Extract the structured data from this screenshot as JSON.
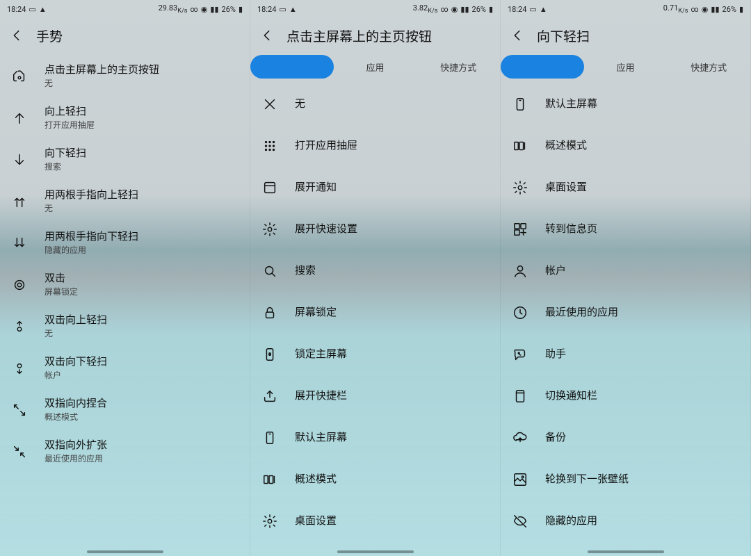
{
  "status": {
    "time": "18:24",
    "battery": "26%",
    "net": [
      {
        "rate": "29.83",
        "unit": "K/s"
      },
      {
        "rate": "3.82",
        "unit": "K/s"
      },
      {
        "rate": "0.71",
        "unit": "K/s"
      }
    ]
  },
  "panels": [
    {
      "title": "手势",
      "rows": [
        {
          "icon": "home-tap",
          "label": "点击主屏幕上的主页按钮",
          "sub": "无"
        },
        {
          "icon": "arrow-up",
          "label": "向上轻扫",
          "sub": "打开应用抽屉"
        },
        {
          "icon": "arrow-down",
          "label": "向下轻扫",
          "sub": "搜索"
        },
        {
          "icon": "two-up",
          "label": "用两根手指向上轻扫",
          "sub": "无"
        },
        {
          "icon": "two-down",
          "label": "用两根手指向下轻扫",
          "sub": "隐藏的应用"
        },
        {
          "icon": "double-tap",
          "label": "双击",
          "sub": "屏幕锁定"
        },
        {
          "icon": "dtap-up",
          "label": "双击向上轻扫",
          "sub": "无"
        },
        {
          "icon": "dtap-down",
          "label": "双击向下轻扫",
          "sub": "帐户"
        },
        {
          "icon": "pinch-in",
          "label": "双指向内捏合",
          "sub": "概述模式"
        },
        {
          "icon": "pinch-out",
          "label": "双指向外扩张",
          "sub": "最近使用的应用"
        }
      ]
    },
    {
      "title": "点击主屏幕上的主页按钮",
      "tabs": [
        "",
        "应用",
        "快捷方式"
      ],
      "rows": [
        {
          "icon": "close",
          "label": "无"
        },
        {
          "icon": "grid",
          "label": "打开应用抽屉"
        },
        {
          "icon": "expand-top",
          "label": "展开通知"
        },
        {
          "icon": "gear",
          "label": "展开快速设置"
        },
        {
          "icon": "search",
          "label": "搜索"
        },
        {
          "icon": "lock",
          "label": "屏幕锁定"
        },
        {
          "icon": "lock-screen",
          "label": "锁定主屏幕"
        },
        {
          "icon": "tray",
          "label": "展开快捷栏"
        },
        {
          "icon": "phone",
          "label": "默认主屏幕"
        },
        {
          "icon": "overview",
          "label": "概述模式"
        },
        {
          "icon": "gear",
          "label": "桌面设置"
        }
      ]
    },
    {
      "title": "向下轻扫",
      "tabs": [
        "",
        "应用",
        "快捷方式"
      ],
      "rows": [
        {
          "icon": "phone",
          "label": "默认主屏幕"
        },
        {
          "icon": "overview",
          "label": "概述模式"
        },
        {
          "icon": "gear",
          "label": "桌面设置"
        },
        {
          "icon": "widgets",
          "label": "转到信息页"
        },
        {
          "icon": "account",
          "label": "帐户"
        },
        {
          "icon": "recent",
          "label": "最近使用的应用"
        },
        {
          "icon": "assistant",
          "label": "助手"
        },
        {
          "icon": "notif-bar",
          "label": "切换通知栏"
        },
        {
          "icon": "backup",
          "label": "备份"
        },
        {
          "icon": "wallpaper",
          "label": "轮换到下一张壁纸"
        },
        {
          "icon": "hidden",
          "label": "隐藏的应用"
        }
      ]
    }
  ]
}
